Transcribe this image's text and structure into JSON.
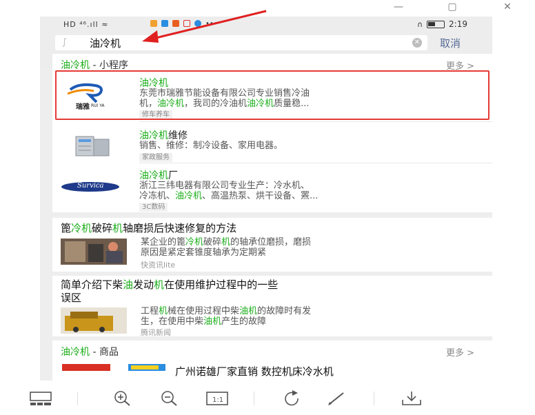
{
  "window": {
    "minimize": "—",
    "maximize": "▢",
    "close": "✕"
  },
  "status": {
    "left": "HD ⁴⁶.ıll ≈",
    "time": "2:19"
  },
  "search": {
    "query": "油冷机",
    "cancel": "取消"
  },
  "mini_section": {
    "title_hl": "油冷机",
    "title_rest": " - 小程序",
    "more": "更多 >",
    "items": [
      {
        "title_hl": "油冷机",
        "title_rest": "",
        "desc1": "东莞市瑞雅节能设备有限公司专业销售冷油",
        "desc2a": "机，",
        "desc2b": "油冷机",
        "desc2c": "，我司的冷油机",
        "desc2d": "油冷机",
        "desc2e": "质量稳...",
        "tag": "修车养车",
        "logo_text": "瑞雅",
        "logo_sub": "RUI YA"
      },
      {
        "title_hl": "油冷机",
        "title_rest": "维修",
        "desc1": "销售、维修：制冷设备、家用电器。",
        "tag": "家政服务"
      },
      {
        "title_hl": "油冷机",
        "title_rest": "厂",
        "desc1": "浙江三纬电器有限公司专业生产：冷水机、",
        "desc2a": "冷冻机、",
        "desc2b": "油冷机",
        "desc2c": "、高温热泵、烘干设备、罴...",
        "tag": "3C数码",
        "logo_text": "Survica"
      }
    ]
  },
  "articles": [
    {
      "t1": "篦",
      "t2": "冷机",
      "t3": "破碎",
      "t4": "机",
      "t5": "轴磨损后快速修复的方法",
      "d1": "某企业的篦",
      "d2": "冷机",
      "d3": "破碎",
      "d4": "机",
      "d5": "的轴承位磨损，磨损",
      "d6": "原因是紧定套锥度轴承为定期紧",
      "source": "快资讯lite"
    },
    {
      "t1": "简单介绍下柴",
      "t2": "油",
      "t3": "发动",
      "t4": "机",
      "t5": "在使用维护过程中的一些",
      "t6": "误区",
      "d1": "工程",
      "d2": "机",
      "d3": "械在使用过程中柴",
      "d4": "油机",
      "d5": "的故障时有发",
      "d6": "生，在使用中柴",
      "d7": "油机",
      "d8": "产生的故障",
      "source": "腾讯新闻"
    }
  ],
  "goods_section": {
    "title_hl": "油冷机",
    "title_rest": " - 商品",
    "more": "更多 >",
    "item_title": "广州诺雄厂家直销 数控机床冷水机"
  },
  "colors": {
    "accent_green": "#1aad19",
    "link_blue": "#576b95",
    "highlight_red": "#e53935"
  }
}
